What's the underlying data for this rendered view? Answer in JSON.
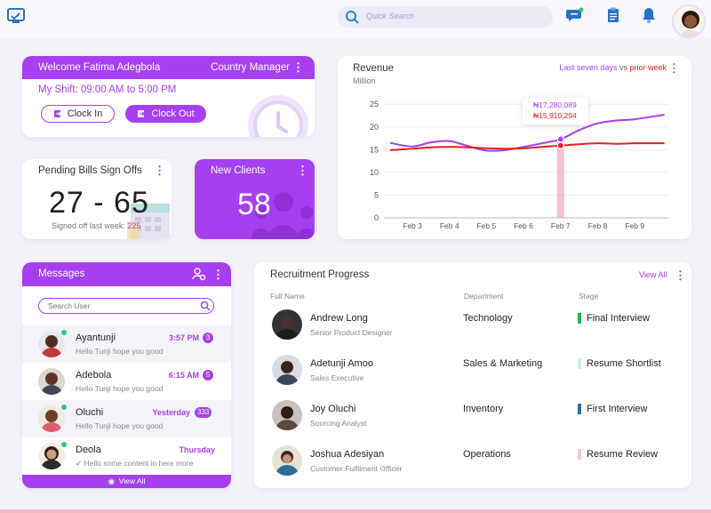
{
  "topbar": {
    "search_placeholder": "Quick Search",
    "icons": [
      "dashboard-logo-icon",
      "chat-icon",
      "clipboard-icon",
      "bell-icon"
    ]
  },
  "welcome": {
    "title": "Welcome Fatima Adegbola",
    "role": "Country Manager",
    "shift": "My Shift: 09:00 AM to 5:00 PM",
    "clock_in": "Clock In",
    "clock_out": "Clock Out"
  },
  "pending": {
    "title": "Pending Bills Sign Offs",
    "value": "27 - 65",
    "sub_label": "Signed off last week:",
    "sub_value": "225"
  },
  "clients": {
    "title": "New Clients",
    "value": "58"
  },
  "revenue": {
    "title": "Revenue",
    "unit": "Million",
    "legend_a": "Last seven days",
    "legend_vs": "vs",
    "legend_b": "prior week",
    "tooltip_a": "₦17,280,089",
    "tooltip_b": "₦15,910,294",
    "colors": {
      "current": "#a63ff0",
      "prior": "#e02020"
    }
  },
  "chart_data": {
    "type": "line",
    "title": "Revenue",
    "ylabel": "Million",
    "xlabel": "",
    "categories": [
      "Feb 3",
      "Feb 4",
      "Feb 5",
      "Feb 6",
      "Feb 7",
      "Feb 8",
      "Feb 9"
    ],
    "x": [
      0,
      1,
      2,
      3,
      4,
      5,
      6
    ],
    "yticks": [
      0,
      5,
      10,
      15,
      20,
      25
    ],
    "ylim": [
      0,
      27
    ],
    "grid": true,
    "highlight_category": "Feb 7",
    "series": [
      {
        "name": "Last seven days",
        "color": "#a63ff0",
        "x": [
          -0.6,
          0,
          0.5,
          1,
          1.5,
          2,
          2.5,
          3,
          3.5,
          4,
          4.5,
          5,
          5.5,
          6,
          6.8
        ],
        "y": [
          16.5,
          15.7,
          16.6,
          16.9,
          15.8,
          14.8,
          14.9,
          15.6,
          16.4,
          17.3,
          19.3,
          20.8,
          21.4,
          21.7,
          22.7
        ]
      },
      {
        "name": "prior week",
        "color": "#e02020",
        "x": [
          -0.6,
          0,
          0.5,
          1,
          1.5,
          2,
          2.5,
          3,
          3.5,
          4,
          4.5,
          5,
          5.5,
          6,
          6.8
        ],
        "y": [
          14.9,
          15.2,
          15.5,
          15.6,
          15.5,
          15.3,
          15.2,
          15.3,
          15.6,
          15.9,
          16.2,
          16.4,
          16.3,
          16.4,
          16.4
        ]
      }
    ]
  },
  "messages": {
    "title": "Messages",
    "search_placeholder": "Search User",
    "view_all": "View All",
    "items": [
      {
        "name": "Ayantunji",
        "text": "Hello Tunji hope you good",
        "time": "3:57 PM",
        "badge": "3",
        "online": true
      },
      {
        "name": "Adebola",
        "text": "Hello Tunji hope you good",
        "time": "6:15 AM",
        "badge": "5",
        "online": false
      },
      {
        "name": "Oluchi",
        "text": "Hello Tunji hope you good",
        "time": "Yesterday",
        "badge": "333",
        "online": true
      },
      {
        "name": "Deola",
        "text": "Hello some content in here more",
        "time": "Thursday",
        "badge": "",
        "online": true
      }
    ]
  },
  "recruitment": {
    "title": "Recruitment Progress",
    "view_all": "View All",
    "headers": {
      "name": "Full Name",
      "department": "Department",
      "stage": "Stage"
    },
    "rows": [
      {
        "name": "Andrew Long",
        "job": "Senior Product Designer",
        "department": "Technology",
        "stage": "Final Interview",
        "stage_color": "#27ae60"
      },
      {
        "name": "Adetunji Amoo",
        "job": "Sales Executive",
        "department": "Sales & Marketing",
        "stage": "Resume Shortlist",
        "stage_color": "#cfeee8"
      },
      {
        "name": "Joy Oluchi",
        "job": "Sourcing Analyst",
        "department": "Inventory",
        "stage": "First Interview",
        "stage_color": "#2f6f9f"
      },
      {
        "name": "Joshua Adesiyan",
        "job": "Customer Fulfilment Officer",
        "department": "Operations",
        "stage": "Resume Review",
        "stage_color": "#f3c7cc"
      }
    ]
  }
}
